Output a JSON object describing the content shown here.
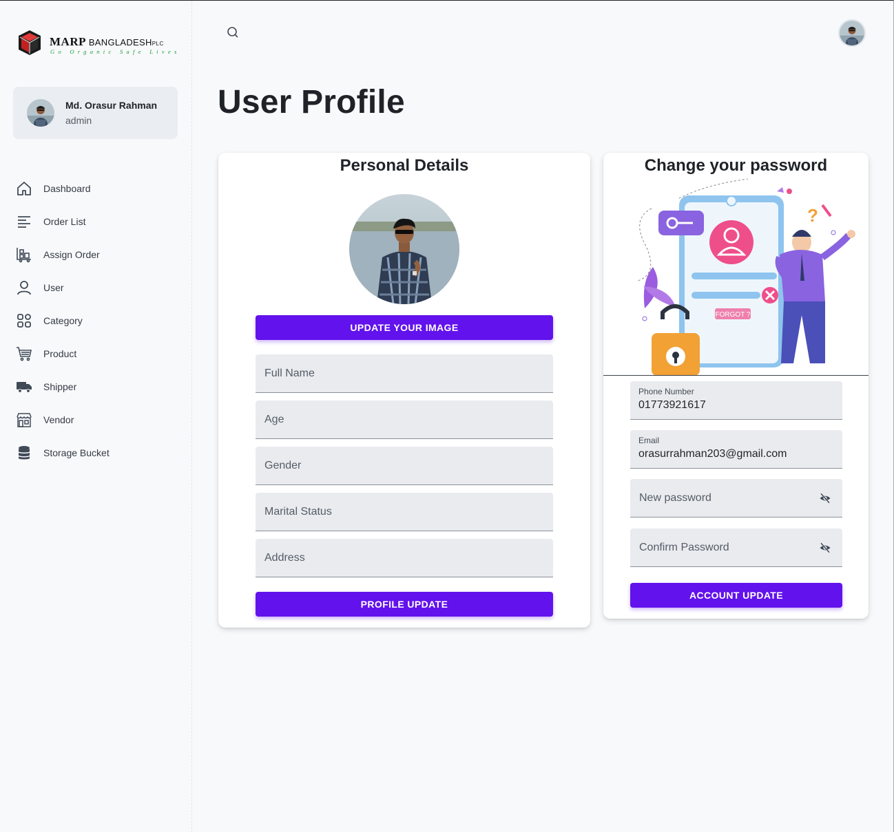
{
  "brand": {
    "name_red": "MA",
    "name_rest": "RP",
    "name_suffix": "BANGLADESH",
    "name_plc": "PLC",
    "tagline": "Go Organic Safe Lives"
  },
  "user": {
    "name": "Md. Orasur Rahman",
    "role": "admin"
  },
  "sidebar": {
    "items": [
      {
        "label": "Dashboard",
        "icon": "home-icon"
      },
      {
        "label": "Order List",
        "icon": "list-icon"
      },
      {
        "label": "Assign Order",
        "icon": "assign-order-icon"
      },
      {
        "label": "User",
        "icon": "user-icon"
      },
      {
        "label": "Category",
        "icon": "category-icon"
      },
      {
        "label": "Product",
        "icon": "cart-icon"
      },
      {
        "label": "Shipper",
        "icon": "truck-icon"
      },
      {
        "label": "Vendor",
        "icon": "store-icon"
      },
      {
        "label": "Storage Bucket",
        "icon": "database-icon"
      }
    ]
  },
  "page": {
    "title": "User Profile"
  },
  "personal": {
    "title": "Personal Details",
    "update_image_label": "UPDATE YOUR IMAGE",
    "fields": {
      "full_name": "Full Name",
      "age": "Age",
      "gender": "Gender",
      "marital_status": "Marital Status",
      "address": "Address"
    },
    "submit_label": "PROFILE UPDATE"
  },
  "password": {
    "title": "Change your password",
    "illustration_text": {
      "forgot": "FORGOT ?"
    },
    "phone": {
      "label": "Phone Number",
      "value": "01773921617"
    },
    "email": {
      "label": "Email",
      "value": "orasurrahman203@gmail.com"
    },
    "new_password_placeholder": "New password",
    "confirm_password_placeholder": "Confirm Password",
    "submit_label": "ACCOUNT UPDATE"
  },
  "colors": {
    "accent": "#6212ec",
    "background": "#f8f9fb",
    "field_bg": "#e9ebef"
  }
}
